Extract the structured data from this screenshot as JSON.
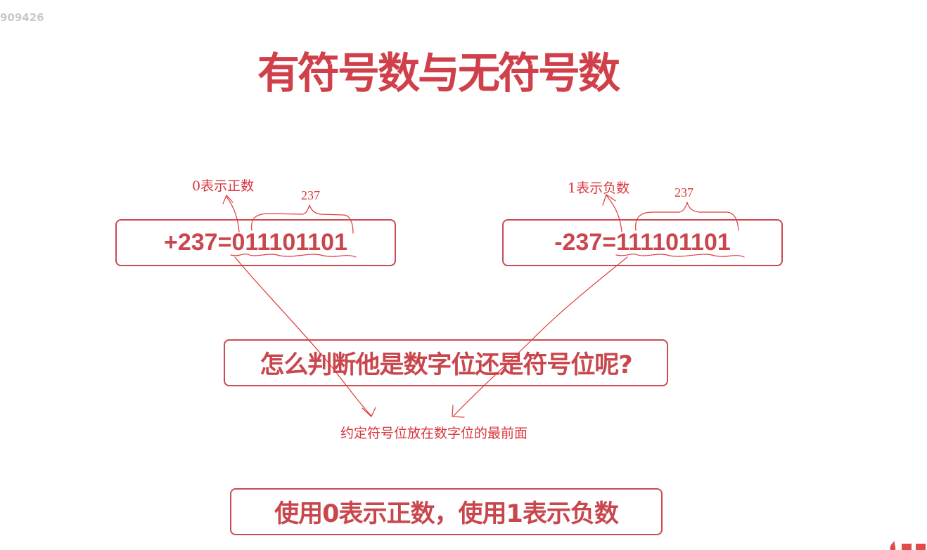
{
  "watermark_id": "909426",
  "title": "有符号数与无符号数",
  "boxes": {
    "positive": "+237=011101101",
    "negative": "-237=111101101",
    "question": "怎么判断他是数字位还是符号位呢?",
    "rule": "使用0表示正数，使用1表示负数"
  },
  "annotations": {
    "zero_positive": "0表示正数",
    "one_negative": "1表示负数",
    "magnitude_left": "237",
    "magnitude_right": "237",
    "convention": "约定符号位放在数字位的最前面"
  },
  "colors": {
    "accent": "#d0404a",
    "ink": "#e03a3a",
    "border": "#cc4a52"
  }
}
